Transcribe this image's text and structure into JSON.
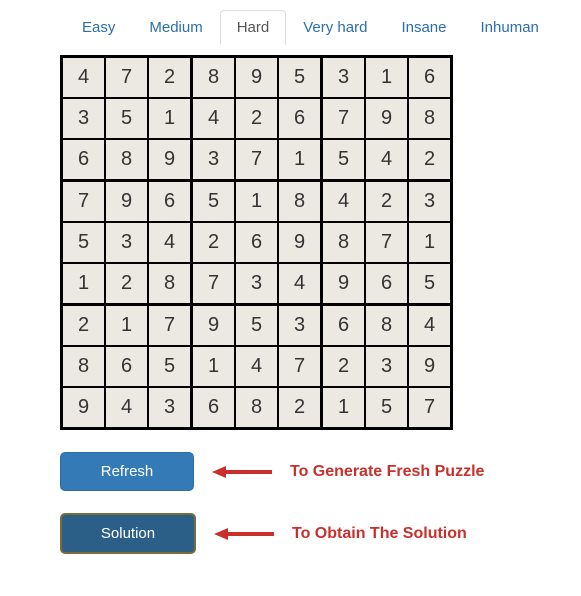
{
  "tabs": {
    "items": [
      "Easy",
      "Medium",
      "Hard",
      "Very hard",
      "Insane",
      "Inhuman"
    ],
    "active_index": 2
  },
  "grid": [
    [
      4,
      7,
      2,
      8,
      9,
      5,
      3,
      1,
      6
    ],
    [
      3,
      5,
      1,
      4,
      2,
      6,
      7,
      9,
      8
    ],
    [
      6,
      8,
      9,
      3,
      7,
      1,
      5,
      4,
      2
    ],
    [
      7,
      9,
      6,
      5,
      1,
      8,
      4,
      2,
      3
    ],
    [
      5,
      3,
      4,
      2,
      6,
      9,
      8,
      7,
      1
    ],
    [
      1,
      2,
      8,
      7,
      3,
      4,
      9,
      6,
      5
    ],
    [
      2,
      1,
      7,
      9,
      5,
      3,
      6,
      8,
      4
    ],
    [
      8,
      6,
      5,
      1,
      4,
      7,
      2,
      3,
      9
    ],
    [
      9,
      4,
      3,
      6,
      8,
      2,
      1,
      5,
      7
    ]
  ],
  "buttons": {
    "refresh": "Refresh",
    "solution": "Solution"
  },
  "annotations": {
    "refresh": "To Generate Fresh Puzzle",
    "solution": "To Obtain The Solution"
  },
  "colors": {
    "tab_link": "#2a6eb0",
    "tab_active_text": "#555555",
    "cell_bg": "#ebe9e2",
    "btn_refresh": "#337ab7",
    "btn_solution": "#2b5f88",
    "annotation_red": "#c9302c"
  },
  "icons": {
    "arrow": "arrow-left-icon"
  }
}
